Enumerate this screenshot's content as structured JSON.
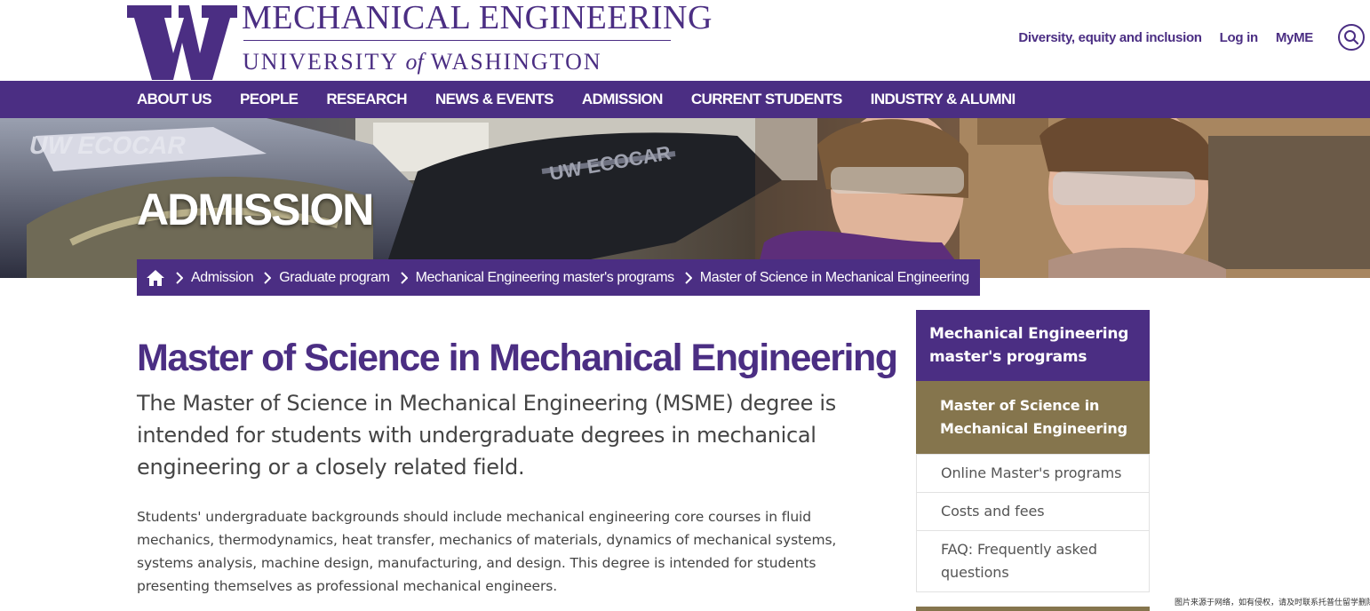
{
  "logo": {
    "line1": "MECHANICAL ENGINEERING",
    "line2_a": "UNIVERSITY",
    "line2_of": "of",
    "line2_b": "WASHINGTON"
  },
  "utility_nav": [
    {
      "label": "Diversity, equity and inclusion"
    },
    {
      "label": "Log in"
    },
    {
      "label": "MyME"
    }
  ],
  "main_nav": [
    {
      "label": "ABOUT US"
    },
    {
      "label": "PEOPLE"
    },
    {
      "label": "RESEARCH"
    },
    {
      "label": "NEWS & EVENTS"
    },
    {
      "label": "ADMISSION"
    },
    {
      "label": "CURRENT STUDENTS"
    },
    {
      "label": "INDUSTRY & ALUMNI"
    }
  ],
  "hero": {
    "title": "ADMISSION"
  },
  "breadcrumb": [
    {
      "label": "Admission"
    },
    {
      "label": "Graduate program"
    },
    {
      "label": "Mechanical Engineering master's programs"
    },
    {
      "label": "Master of Science in Mechanical Engineering"
    }
  ],
  "main": {
    "title": "Master of Science in Mechanical Engineering",
    "lead": "The Master of Science in Mechanical Engineering (MSME) degree is intended for students with undergraduate degrees in mechanical engineering or a closely related field.",
    "body": "Students' undergraduate backgrounds should include mechanical engineering core courses in fluid mechanics, thermodynamics, heat transfer, mechanics of materials, dynamics of mechanical systems, systems analysis, machine design, manufacturing, and design. This degree is intended for students presenting themselves as professional mechanical engineers."
  },
  "sidebar": {
    "heading": "Mechanical Engineering master's programs",
    "active": "Master of Science in Mechanical Engineering",
    "items": [
      {
        "label": "Online Master's programs"
      },
      {
        "label": "Costs and fees"
      },
      {
        "label": "FAQ: Frequently asked questions"
      }
    ]
  },
  "watermark": "图片来源于网络，如有侵权，请及时联系托普仕留学删除",
  "colors": {
    "purple": "#4b2e83",
    "gold": "#85754d"
  }
}
